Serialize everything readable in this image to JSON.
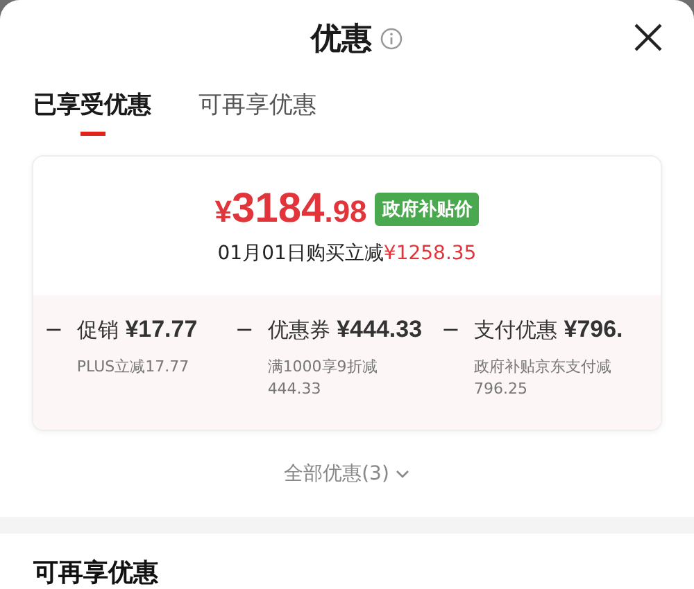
{
  "header": {
    "title": "优惠"
  },
  "tabs": [
    {
      "label": "已享受优惠",
      "selected": true
    },
    {
      "label": "可再享优惠",
      "selected": false
    }
  ],
  "summary": {
    "symbol": "¥",
    "integer": "3184",
    "decimal": ".98",
    "badge": "政府补贴价",
    "note": "01月01日购买立减",
    "note_amount": "¥1258.35"
  },
  "discounts": [
    {
      "sign": "−",
      "label": "促销",
      "amount": "¥17.77",
      "detail": "PLUS立减17.77"
    },
    {
      "sign": "−",
      "label": "优惠券",
      "amount": "¥444.33",
      "detail": "满1000享9折减444.33"
    },
    {
      "sign": "−",
      "label": "支付优惠",
      "amount": "¥796.",
      "detail": "政府补贴京东支付减796.25"
    }
  ],
  "all_link": "全部优惠(3)",
  "section_heading": "可再享优惠"
}
